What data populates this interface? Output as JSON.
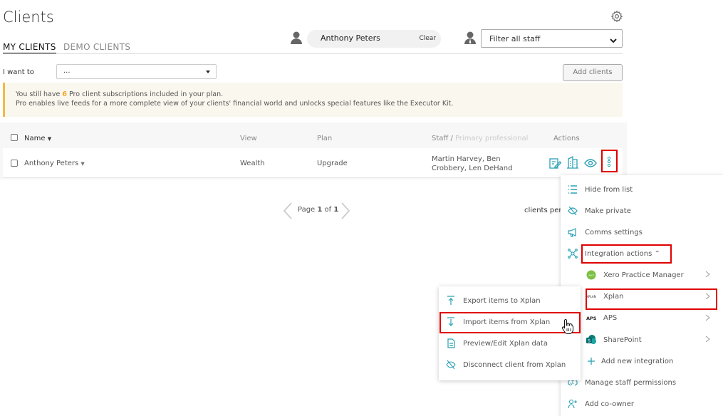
{
  "page": {
    "title": "Clients"
  },
  "tabs": [
    {
      "label": "MY CLIENTS",
      "active": true
    },
    {
      "label": "DEMO CLIENTS",
      "active": false
    }
  ],
  "client_filter": {
    "value": "Anthony Peters",
    "clear_label": "Clear"
  },
  "staff_filter": {
    "value": "Filter all staff"
  },
  "actions_bar": {
    "i_want_label": "I want to",
    "i_want_value": "...",
    "add_clients_label": "Add clients"
  },
  "banner": {
    "line1_prefix": "You still have ",
    "line1_count": "6",
    "line1_suffix": " Pro client subscriptions included in your plan.",
    "line2": "Pro enables live feeds for a more complete view of your clients' financial world and unlocks special features like the Executor Kit."
  },
  "table": {
    "headers": {
      "name": "Name",
      "view": "View",
      "plan": "Plan",
      "staff": "Staff /",
      "staff_sub": "Primary professional",
      "actions": "Actions"
    },
    "rows": [
      {
        "name": "Anthony Peters",
        "view": "Wealth",
        "plan": "Upgrade",
        "staff_line1": "Martin Harvey, Ben",
        "staff_line2": "Crobbery, Len DeHand"
      }
    ]
  },
  "pagination": {
    "prefix": "Page ",
    "current": "1",
    "middle": " of ",
    "total": "1",
    "clients_per": "clients per"
  },
  "context_menu": {
    "items": [
      {
        "label": "Hide from list",
        "icon": "list-icon"
      },
      {
        "label": "Make private",
        "icon": "eye-off-icon"
      },
      {
        "label": "Comms settings",
        "icon": "megaphone-icon"
      },
      {
        "label": "Integration actions",
        "icon": "integration-icon"
      },
      {
        "label": "Xero Practice Manager",
        "icon": "xero-icon",
        "logo_text": "xero"
      },
      {
        "label": "Xplan",
        "icon": "xplan-icon",
        "logo_text": "XPLAN"
      },
      {
        "label": "APS",
        "icon": "aps-icon",
        "logo_text": "APS"
      },
      {
        "label": "SharePoint",
        "icon": "sharepoint-icon",
        "logo_text": "S"
      },
      {
        "label": "Add new integration",
        "icon": "plus-icon"
      },
      {
        "label": "Manage staff permissions",
        "icon": "handshake-icon"
      },
      {
        "label": "Add co-owner",
        "icon": "add-user-icon"
      }
    ]
  },
  "xplan_submenu": {
    "items": [
      {
        "label": "Export items to Xplan",
        "icon": "upload-icon"
      },
      {
        "label": "Import items from Xplan",
        "icon": "download-icon"
      },
      {
        "label": "Preview/Edit Xplan data",
        "icon": "document-icon"
      },
      {
        "label": "Disconnect client from Xplan",
        "icon": "disconnect-icon"
      }
    ]
  },
  "colors": {
    "accent": "#2aa0b5",
    "highlight_box": "#e00000",
    "banner_border": "#f5b942",
    "xero_green": "#7ac143"
  }
}
